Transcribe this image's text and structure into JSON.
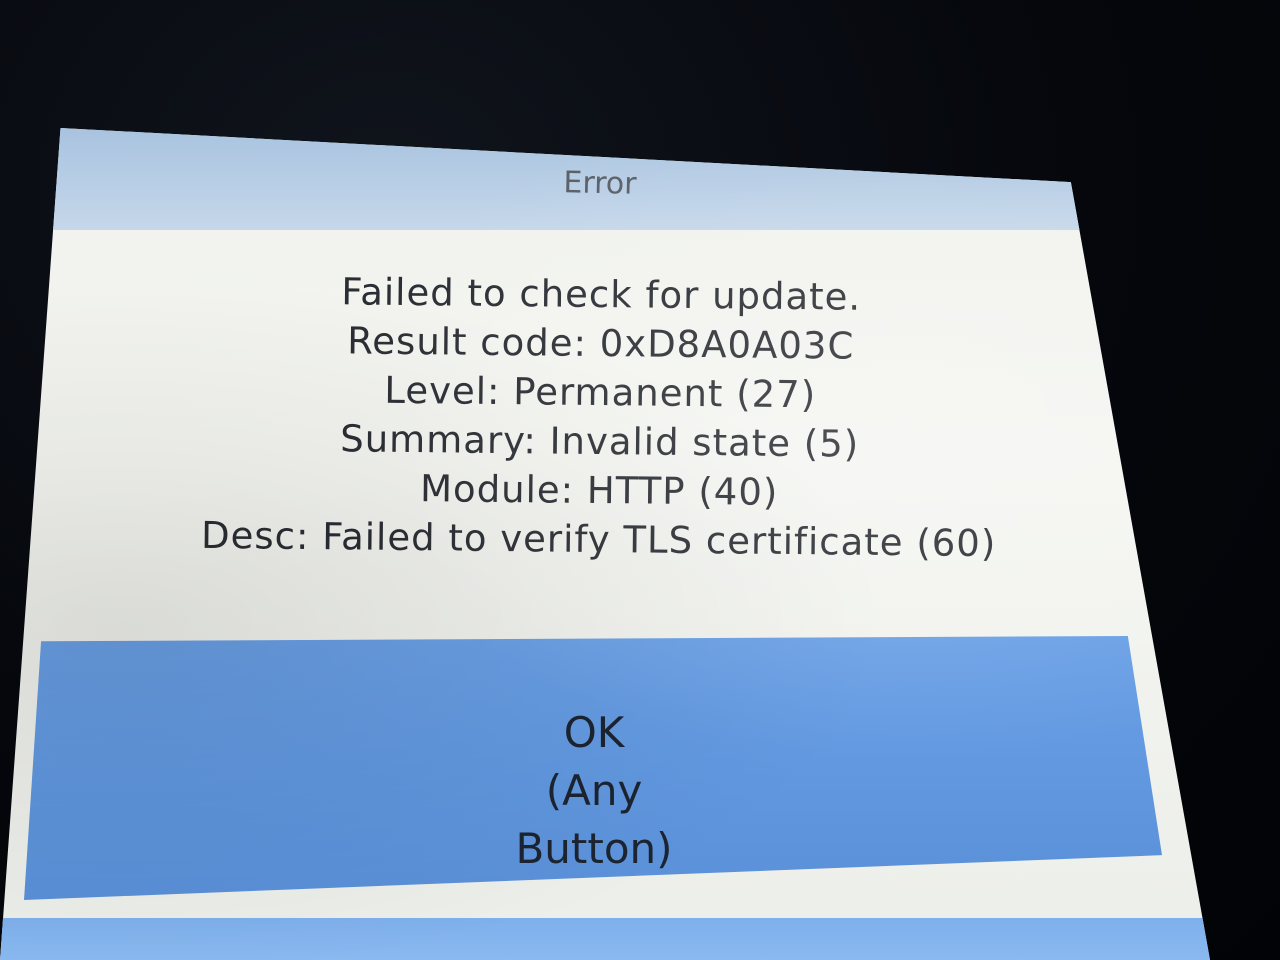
{
  "dialog": {
    "title": "Error",
    "lines": [
      "Failed to check for update.",
      "Result code: 0xD8A0A03C",
      "Level: Permanent (27)",
      "Summary: Invalid state (5)",
      "Module: HTTP (40)",
      "Desc: Failed to verify TLS certificate (60)"
    ],
    "ok_button": {
      "label": "OK",
      "hint": "(Any Button)"
    }
  },
  "colors": {
    "title_bar": "#b3cae3",
    "background": "#f2f3ef",
    "button": "#6198e0",
    "text": "#2a2d33"
  }
}
